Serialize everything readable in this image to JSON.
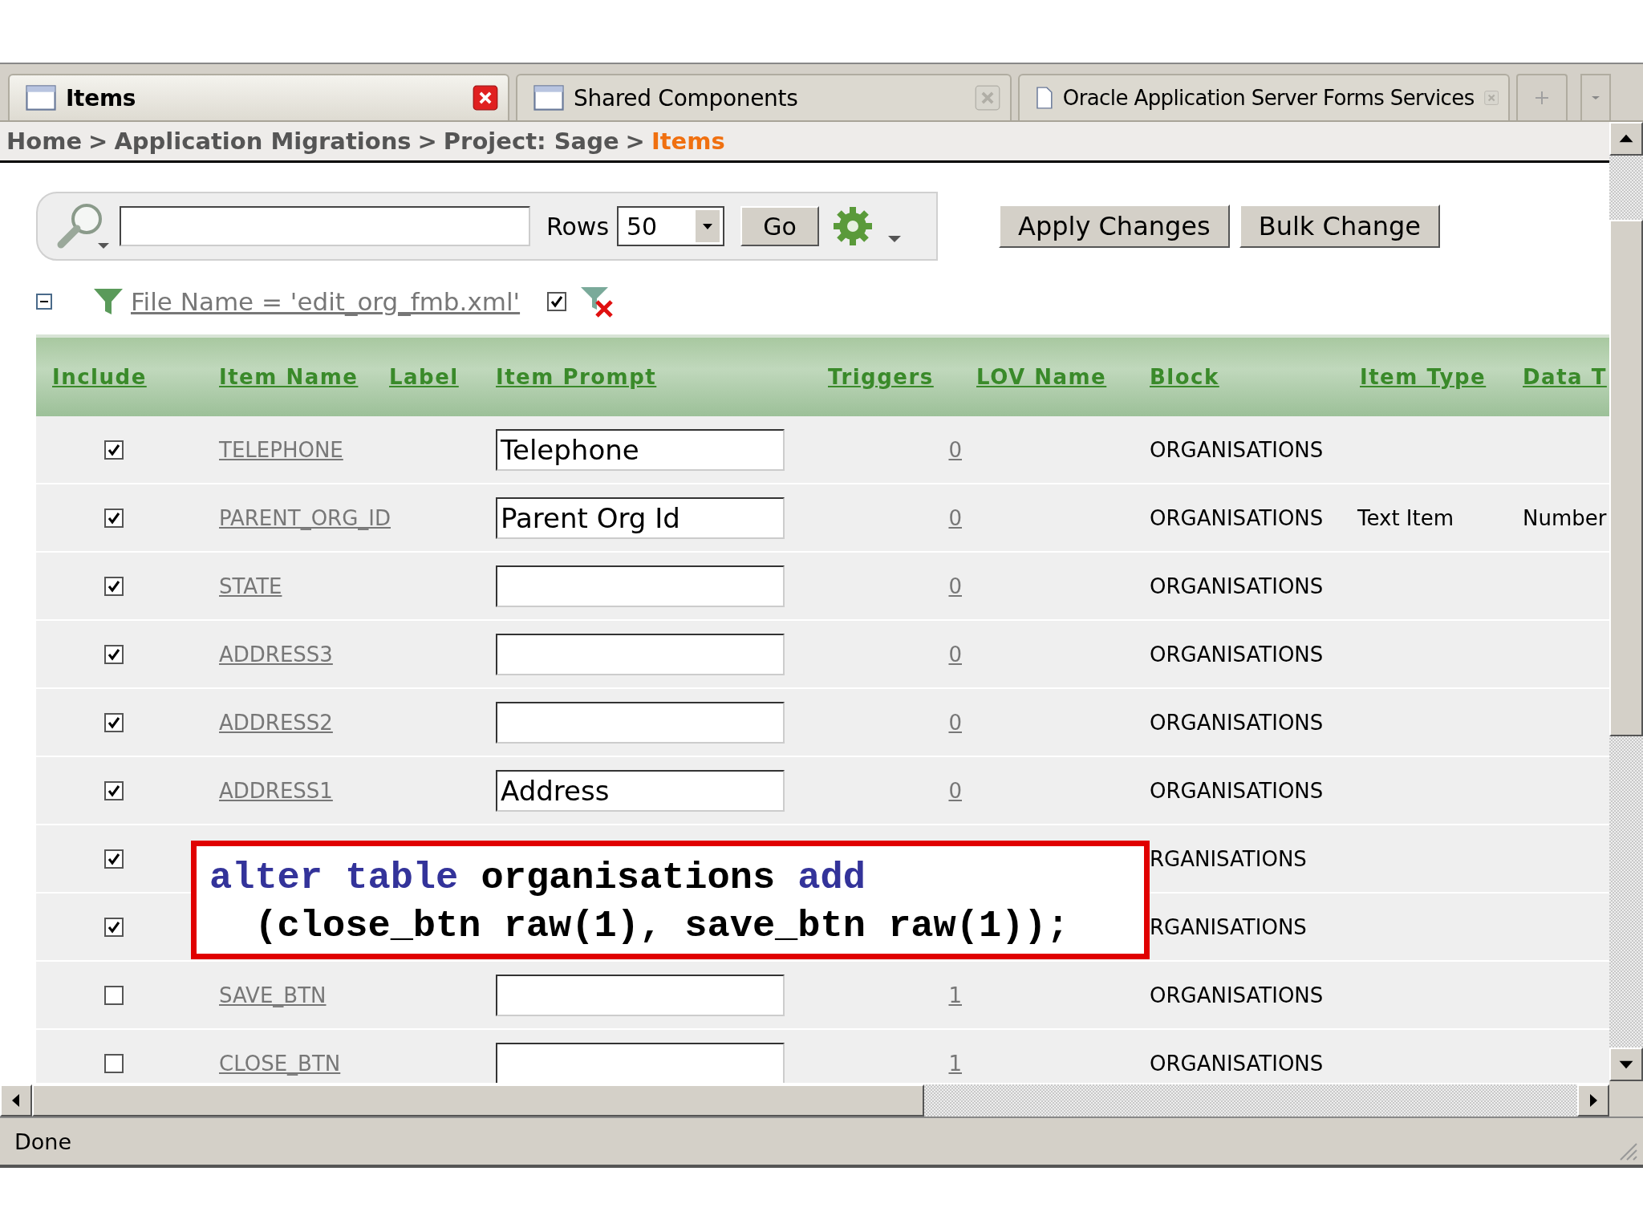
{
  "tabs": [
    {
      "label": "Items",
      "selected": true
    },
    {
      "label": "Shared Components",
      "selected": false
    },
    {
      "label": "Oracle Application Server Forms Services",
      "selected": false
    }
  ],
  "breadcrumb": [
    {
      "label": "Home",
      "current": false
    },
    {
      "label": "Application Migrations",
      "current": false
    },
    {
      "label": "Project: Sage",
      "current": false
    },
    {
      "label": "Items",
      "current": true
    }
  ],
  "breadcrumb_separator": ">",
  "toolbar": {
    "rows_label": "Rows",
    "rows_value": "50",
    "go": "Go",
    "buttons": [
      "Apply Changes",
      "Bulk Change"
    ]
  },
  "filter": {
    "text": "File Name = 'edit_org_fmb.xml'",
    "enabled": true
  },
  "table": {
    "columns": [
      "Include",
      "Item Name",
      "Label",
      "Item Prompt",
      "Triggers",
      "LOV Name",
      "Block",
      "Item Type",
      "Data T"
    ],
    "rows": [
      {
        "included": true,
        "item_name": "TELEPHONE",
        "prompt": "Telephone",
        "triggers": "0",
        "block": "ORGANISATIONS"
      },
      {
        "included": true,
        "item_name": "PARENT_ORG_ID",
        "prompt": "Parent Org Id",
        "triggers": "0",
        "block": "ORGANISATIONS",
        "item_type": "Text Item",
        "data_type": "Number"
      },
      {
        "included": true,
        "item_name": "STATE",
        "prompt": "",
        "triggers": "0",
        "block": "ORGANISATIONS"
      },
      {
        "included": true,
        "item_name": "ADDRESS3",
        "prompt": "",
        "triggers": "0",
        "block": "ORGANISATIONS"
      },
      {
        "included": true,
        "item_name": "ADDRESS2",
        "prompt": "",
        "triggers": "0",
        "block": "ORGANISATIONS"
      },
      {
        "included": true,
        "item_name": "ADDRESS1",
        "prompt": "Address",
        "triggers": "0",
        "block": "ORGANISATIONS"
      },
      {
        "included": true,
        "block": "RGANISATIONS"
      },
      {
        "included": true,
        "block": "RGANISATIONS"
      },
      {
        "included": false,
        "item_name": "SAVE_BTN",
        "prompt": "",
        "triggers": "1",
        "block": "ORGANISATIONS"
      },
      {
        "included": false,
        "item_name": "CLOSE_BTN",
        "prompt": "",
        "triggers": "1",
        "block": "ORGANISATIONS"
      }
    ]
  },
  "callout": {
    "lines": [
      [
        {
          "kind": "keyword",
          "text": "alter table"
        },
        {
          "kind": "plain",
          "text": " organisations "
        },
        {
          "kind": "keyword",
          "text": "add"
        }
      ],
      [
        {
          "kind": "plain",
          "text": "  (close_btn raw(1), save_btn raw(1));"
        }
      ]
    ]
  },
  "status_bar": "Done"
}
